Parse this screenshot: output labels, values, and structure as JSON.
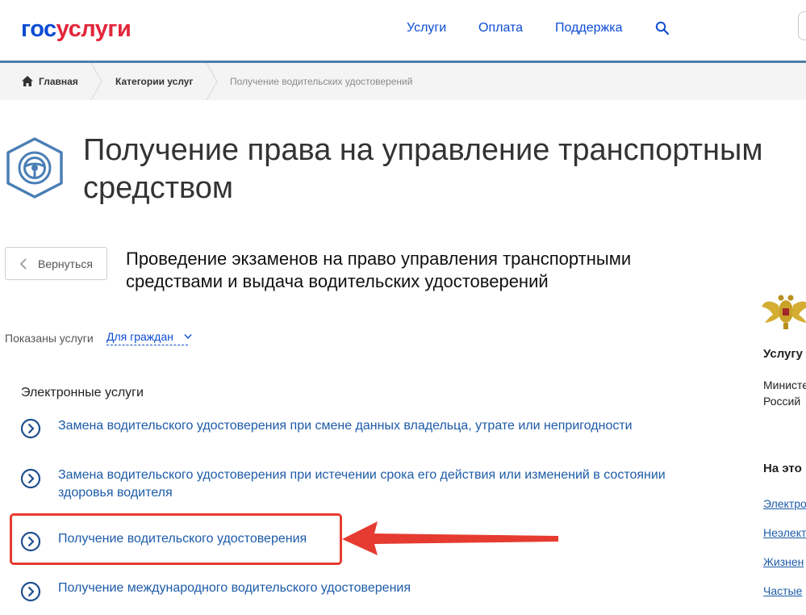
{
  "header": {
    "logo_part1": "гос",
    "logo_part2": "услуги",
    "nav": [
      "Услуги",
      "Оплата",
      "Поддержка"
    ]
  },
  "breadcrumbs": [
    "Главная",
    "Категории услуг",
    "Получение водительских удостоверений"
  ],
  "page_title": "Получение права на управление транспортным средством",
  "back_label": "Вернуться",
  "service_title": "Проведение экзаменов на право управления транспортными средствами и выдача водительских удостоверений",
  "filter": {
    "label": "Показаны услуги",
    "value": "Для граждан"
  },
  "section_heading": "Электронные услуги",
  "services": [
    "Замена водительского удостоверения при смене данных владельца, утрате или непригодности",
    "Замена водительского удостоверения при истечении срока его действия или изменений в состоянии здоровья водителя",
    "Получение водительского удостоверения",
    "Получение международного водительского удостоверения"
  ],
  "sidebar": {
    "provider_heading": "Услугу",
    "provider_line1": "Министе",
    "provider_line2": "Россий",
    "on_page_heading": "На это",
    "links": [
      "Электро",
      "Неэлект",
      "Жизнен",
      "Частые"
    ]
  },
  "colors": {
    "brand_blue": "#0d4cd3",
    "brand_red": "#e3263b",
    "link": "#1d5ba8",
    "highlight": "#e63b30"
  }
}
